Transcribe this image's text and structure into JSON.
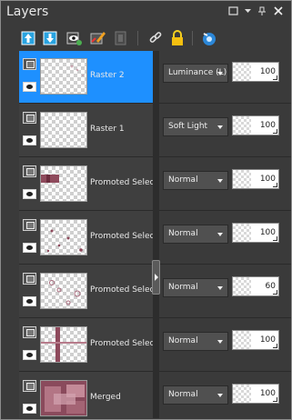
{
  "window": {
    "title": "Layers",
    "controls": [
      "restore-icon",
      "dropdown-icon",
      "pin-icon",
      "close-icon"
    ]
  },
  "toolbar": {
    "icons": [
      "move-layer-up-icon",
      "move-layer-down-icon",
      "visibility-toggle-icon",
      "edit-layer-icon",
      "mask-icon",
      "link-icon",
      "lock-icon",
      "layer-properties-icon"
    ]
  },
  "colors": {
    "panel_bg": "#3a3a3a",
    "selection": "#1e90ff",
    "thumb_mauve": "#8e4a5c"
  },
  "layers": [
    {
      "name": "Raster 2",
      "blend": "Luminance (L)",
      "opacity": "100",
      "selected": true
    },
    {
      "name": "Raster 1",
      "blend": "Soft Light",
      "opacity": "100",
      "selected": false
    },
    {
      "name": "Promoted Selection",
      "blend": "Normal",
      "opacity": "100",
      "selected": false
    },
    {
      "name": "Promoted Selection",
      "blend": "Normal",
      "opacity": "100",
      "selected": false
    },
    {
      "name": "Promoted Selection",
      "blend": "Normal",
      "opacity": "60",
      "selected": false
    },
    {
      "name": "Promoted Selection",
      "blend": "Normal",
      "opacity": "100",
      "selected": false
    },
    {
      "name": "Merged",
      "blend": "Normal",
      "opacity": "100",
      "selected": false
    }
  ]
}
